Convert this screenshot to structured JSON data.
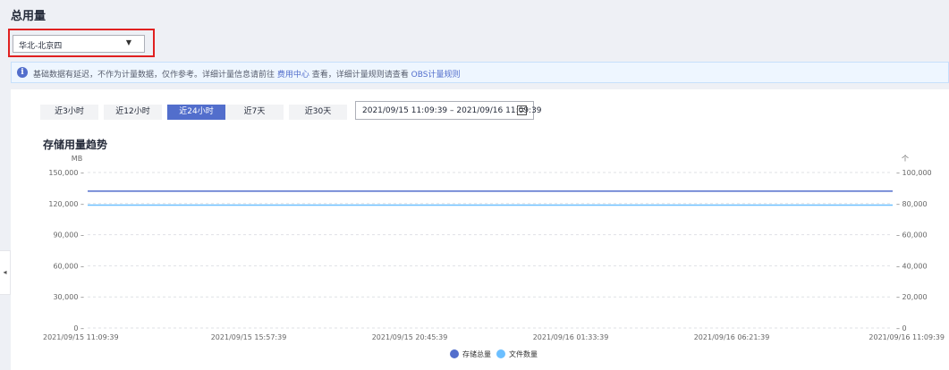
{
  "page": {
    "title": "总用量"
  },
  "region_select": {
    "value": "华北-北京四",
    "icon": "chevron-down-icon"
  },
  "info_bar": {
    "icon": "info-icon",
    "text_before": "基础数据有延迟，不作为计量数据，仅作参考。详细计量信息请前往 ",
    "link_billing": "费用中心",
    "text_middle": " 查看，详细计量规则请查看 ",
    "link_rules": "OBS计量规则"
  },
  "time_ranges": [
    {
      "label": "近3小时",
      "active": false
    },
    {
      "label": "近12小时",
      "active": false
    },
    {
      "label": "近24小时",
      "active": true
    },
    {
      "label": "近7天",
      "active": false
    },
    {
      "label": "近30天",
      "active": false
    }
  ],
  "date_range": {
    "text": "2021/09/15 11:09:39 – 2021/09/16 11:09:39",
    "icon": "calendar-icon"
  },
  "chart_data": {
    "type": "line",
    "title": "存储用量趋势",
    "ylabel_left": "MB",
    "ylabel_right": "个",
    "ylim_left": [
      0,
      150000
    ],
    "ylim_right": [
      0,
      100000
    ],
    "yticks_left": [
      "0",
      "30,000",
      "60,000",
      "90,000",
      "120,000",
      "150,000"
    ],
    "yticks_right": [
      "0",
      "20,000",
      "40,000",
      "60,000",
      "80,000",
      "100,000"
    ],
    "x": [
      "2021/09/15 11:09:39",
      "2021/09/15 15:57:39",
      "2021/09/15 20:45:39",
      "2021/09/16 01:33:39",
      "2021/09/16 06:21:39",
      "2021/09/16 11:09:39"
    ],
    "grid": true,
    "legend_position": "bottom",
    "series": [
      {
        "name": "存储总量",
        "axis": "left",
        "color": "#526ecc",
        "values": [
          132000,
          132000,
          132000,
          132000,
          132000,
          132000
        ]
      },
      {
        "name": "文件数量",
        "axis": "right",
        "color": "#6cbfff",
        "values": [
          79000,
          79000,
          79000,
          79000,
          79000,
          79000
        ]
      }
    ]
  }
}
